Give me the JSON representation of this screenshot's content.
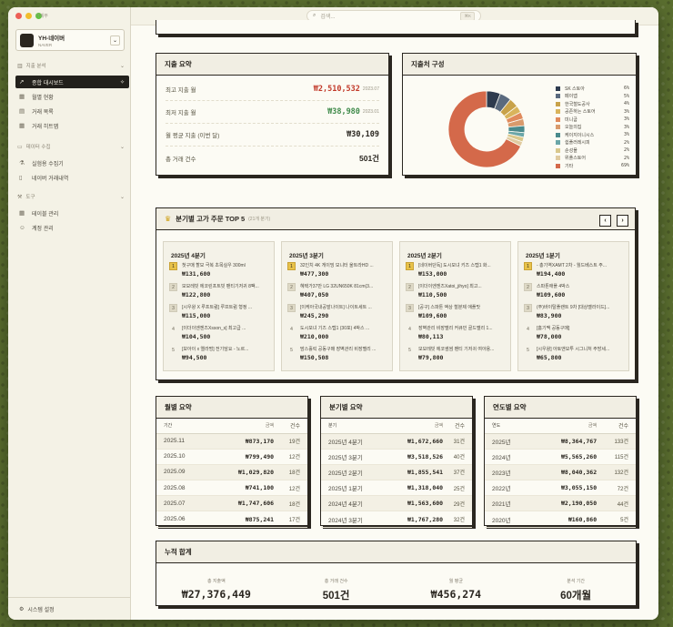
{
  "app": {
    "title": "가계부"
  },
  "account": {
    "name": "YH-네이버",
    "sub": "NAVER"
  },
  "sidebar": {
    "section_analysis": "지출 분석",
    "items_analysis": [
      {
        "label": "종합 대시보드",
        "icon": "trend-icon"
      },
      {
        "label": "월별 현황",
        "icon": "calendar-icon"
      },
      {
        "label": "거래 목록",
        "icon": "list-icon"
      },
      {
        "label": "거래 히트맵",
        "icon": "grid-icon"
      }
    ],
    "section_collect": "데이터 수집",
    "items_collect": [
      {
        "label": "실험용 수집기",
        "icon": "flask-icon"
      },
      {
        "label": "네이버 거래내역",
        "icon": "receipt-icon"
      }
    ],
    "section_tools": "도구",
    "items_tools": [
      {
        "label": "테이블 관리",
        "icon": "table-icon"
      },
      {
        "label": "계정 관리",
        "icon": "users-icon"
      }
    ],
    "footer": "시스템 설정"
  },
  "search": {
    "placeholder": "검색...",
    "shortcut": "⌘K"
  },
  "summary": {
    "title": "지출 요약",
    "max_label": "최고 지출 월",
    "max_value": "₩2,510,532",
    "max_date": "2023.07",
    "min_label": "최저 지출 월",
    "min_value": "₩38,980",
    "min_date": "2023.01",
    "avg_label": "월 평균 지출 (이번 달)",
    "avg_value": "₩30,109",
    "count_label": "총 거래 건수",
    "count_value": "501건"
  },
  "composition": {
    "title": "지출처 구성",
    "legend": [
      {
        "name": "SK 스토아",
        "pct": "6%",
        "color": "#2e3b4e"
      },
      {
        "name": "페이앱",
        "pct": "5%",
        "color": "#5a6a7e"
      },
      {
        "name": "한국철도공사",
        "pct": "4%",
        "color": "#c8a24a"
      },
      {
        "name": "공존하는 스토어",
        "pct": "3%",
        "color": "#d9b45c"
      },
      {
        "name": "미니굽",
        "pct": "3%",
        "color": "#e08a5c"
      },
      {
        "name": "오늘의집",
        "pct": "3%",
        "color": "#d99a6c"
      },
      {
        "name": "케이지이니시스",
        "pct": "3%",
        "color": "#4a8a8c"
      },
      {
        "name": "쉽플러레시피",
        "pct": "2%",
        "color": "#6aa6a8"
      },
      {
        "name": "순성몰",
        "pct": "2%",
        "color": "#d9c88c"
      },
      {
        "name": "위플스토어",
        "pct": "2%",
        "color": "#e0cba0"
      },
      {
        "name": "기타",
        "pct": "69%",
        "color": "#d4694a"
      }
    ]
  },
  "chart_data": {
    "type": "pie",
    "title": "지출처 구성",
    "categories": [
      "SK 스토아",
      "페이앱",
      "한국철도공사",
      "공존하는 스토어",
      "미니굽",
      "오늘의집",
      "케이지이니시스",
      "쉽플러레시피",
      "순성몰",
      "위플스토어",
      "기타"
    ],
    "values": [
      6,
      5,
      4,
      3,
      3,
      3,
      3,
      2,
      2,
      2,
      69
    ]
  },
  "top5": {
    "title": "분기별 고가 주문 TOP 5",
    "subtitle": "(21개 분기)",
    "quarters": [
      {
        "title": "2025년 4분기",
        "items": [
          {
            "rank": "1",
            "name": "첫구매 할모 극복 초목실우 300ml",
            "price": "₩131,600"
          },
          {
            "rank": "2",
            "name": "모모레빗 에코린프트빗 팬티기저귀 8팩...",
            "price": "₩122,800"
          },
          {
            "rank": "3",
            "name": "[시우왕 X 루프트럼] 루프트럼 형정 ...",
            "price": "₩115,000"
          },
          {
            "rank": "4",
            "name": "[이더이엔젠즈Xsson_s] 최고급 ...",
            "price": "₩104,500"
          },
          {
            "rank": "5",
            "name": "[보아이 x 엘라멍] 전기담요 - 노르...",
            "price": "₩94,500"
          }
        ]
      },
      {
        "title": "2025년 3분기",
        "items": [
          {
            "rank": "1",
            "name": "32인치 4K 게이밍 모니터 울트라HD ...",
            "price": "₩477,300"
          },
          {
            "rank": "2",
            "name": "혜택가37만 LG 32UN650K 81cm(3...",
            "price": "₩407,050"
          },
          {
            "rank": "3",
            "name": "[이케아국내공발나이트] 나이트세트 ...",
            "price": "₩245,290"
          },
          {
            "rank": "4",
            "name": "도시모녀 기즈 스텝1 (30포) 4박스 ...",
            "price": "₩210,000"
          },
          {
            "rank": "5",
            "name": "맘스홀릭 공동구매 장벽관리 비장멜리 ...",
            "price": "₩150,508"
          }
        ]
      },
      {
        "title": "2025년 2분기",
        "items": [
          {
            "rank": "1",
            "name": "[네이버단독] 도시모녀 키즈 스텝1 화...",
            "price": "₩153,000"
          },
          {
            "rank": "2",
            "name": "[이더이엔젠즈Xatoi_jihyo] 최고...",
            "price": "₩110,500"
          },
          {
            "rank": "3",
            "name": "[공구] 스파톤 액상 철분제 애플맛",
            "price": "₩109,600"
          },
          {
            "rank": "4",
            "name": "장벽관리 비장멜리 커큐민 골드멜리 1...",
            "price": "₩80,113"
          },
          {
            "rank": "5",
            "name": "모모레빗 에코썸썸 팬티 기저귀 여아용...",
            "price": "₩79,800"
          }
        ]
      },
      {
        "title": "2025년 1분기",
        "items": [
          {
            "rank": "1",
            "name": "- 총기역XAMT 2차 - 월드베스트 주...",
            "price": "₩194,400"
          },
          {
            "rank": "2",
            "name": "스파톤애플 4박스",
            "price": "₩109,600"
          },
          {
            "rank": "3",
            "name": "(주)바이탈플랜트 9차 [대상멜라이드]...",
            "price": "₩83,900"
          },
          {
            "rank": "4",
            "name": "[홈기맥 공동구매]",
            "price": "₩78,000"
          },
          {
            "rank": "5",
            "name": "[시우왕] 아토앤모투 시그니처 주방세...",
            "price": "₩65,800"
          }
        ]
      }
    ]
  },
  "monthly": {
    "title": "월별 요약",
    "headers": [
      "기간",
      "금액",
      "건수"
    ],
    "rows": [
      [
        "2025.11",
        "₩873,170",
        "19건"
      ],
      [
        "2025.10",
        "₩799,490",
        "12건"
      ],
      [
        "2025.09",
        "₩1,029,820",
        "18건"
      ],
      [
        "2025.08",
        "₩741,100",
        "12건"
      ],
      [
        "2025.07",
        "₩1,747,606",
        "18건"
      ],
      [
        "2025.06",
        "₩875,241",
        "17건"
      ]
    ]
  },
  "quarterly": {
    "title": "분기별 요약",
    "headers": [
      "분기",
      "금액",
      "건수"
    ],
    "rows": [
      [
        "2025년 4분기",
        "₩1,672,660",
        "31건"
      ],
      [
        "2025년 3분기",
        "₩3,518,526",
        "40건"
      ],
      [
        "2025년 2분기",
        "₩1,855,541",
        "37건"
      ],
      [
        "2025년 1분기",
        "₩1,318,040",
        "25건"
      ],
      [
        "2024년 4분기",
        "₩1,563,600",
        "29건"
      ],
      [
        "2024년 3분기",
        "₩1,767,280",
        "32건"
      ]
    ]
  },
  "yearly": {
    "title": "연도별 요약",
    "headers": [
      "연도",
      "금액",
      "건수"
    ],
    "rows": [
      [
        "2025년",
        "₩8,364,767",
        "133건"
      ],
      [
        "2024년",
        "₩5,565,260",
        "115건"
      ],
      [
        "2023년",
        "₩8,040,362",
        "132건"
      ],
      [
        "2022년",
        "₩3,055,150",
        "72건"
      ],
      [
        "2021년",
        "₩2,190,050",
        "44건"
      ],
      [
        "2020년",
        "₩160,860",
        "5건"
      ]
    ]
  },
  "cumulative": {
    "title": "누적 합계",
    "items": [
      {
        "label": "총 지출액",
        "value": "₩27,376,449"
      },
      {
        "label": "총 거래 건수",
        "value": "501건"
      },
      {
        "label": "월 평균",
        "value": "₩456,274"
      },
      {
        "label": "분석 기간",
        "value": "60개월"
      }
    ]
  }
}
